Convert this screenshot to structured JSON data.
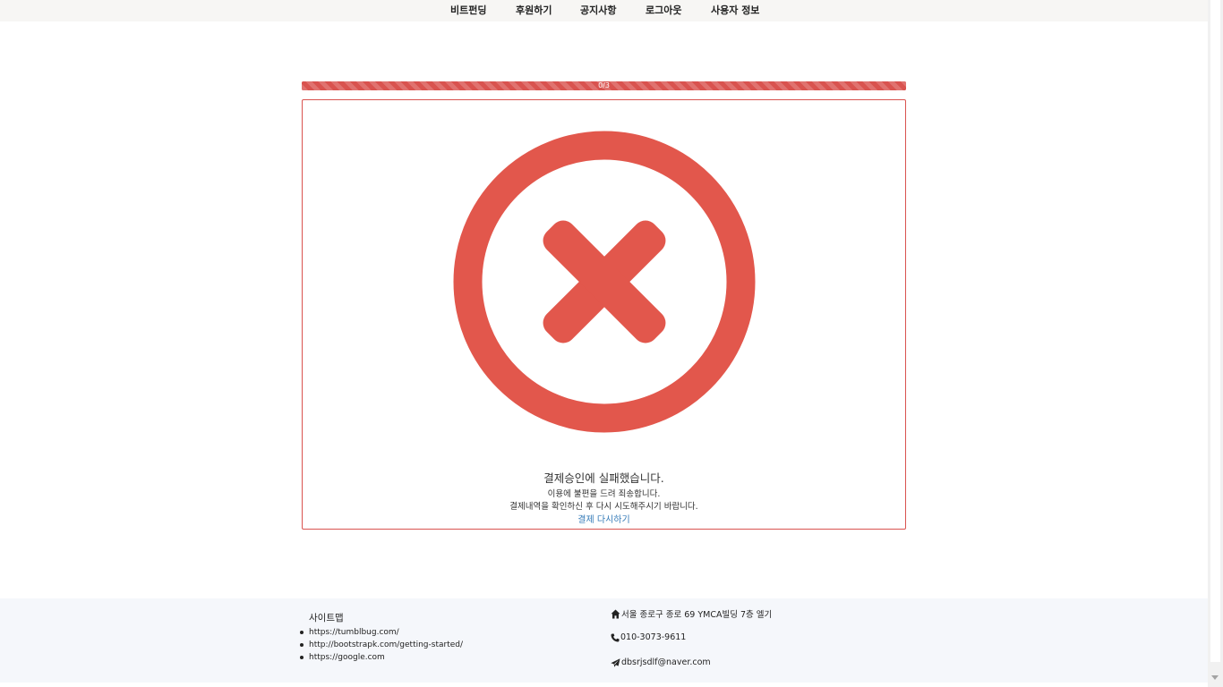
{
  "nav": {
    "items": [
      {
        "label": "비트펀딩"
      },
      {
        "label": "후원하기"
      },
      {
        "label": "공지사항"
      },
      {
        "label": "로그아웃"
      },
      {
        "label": "사용자 정보"
      }
    ]
  },
  "progress": {
    "label": "0/3",
    "fraction": 1.0,
    "color": "#d9534f"
  },
  "result": {
    "icon": "fail-x-circle-icon",
    "icon_color": "#e2574c",
    "title": "결제승인에 실패했습니다.",
    "line1": "이용에 불편을 드려 죄송합니다.",
    "line2": "결제내역을 확인하신 후 다시 시도해주시기 바랍니다.",
    "retry_label": "결제 다시하기"
  },
  "footer": {
    "sitemap_title": "사이트맵",
    "sitemap_links": [
      "https://tumblbug.com/",
      "http://bootstrapk.com/getting-started/",
      "https://google.com"
    ],
    "address": "서울 종로구 종로 69 YMCA빌딩 7층 엘기",
    "phone": "010-3073-9611",
    "email": "dbsrjsdlf@naver.com"
  }
}
